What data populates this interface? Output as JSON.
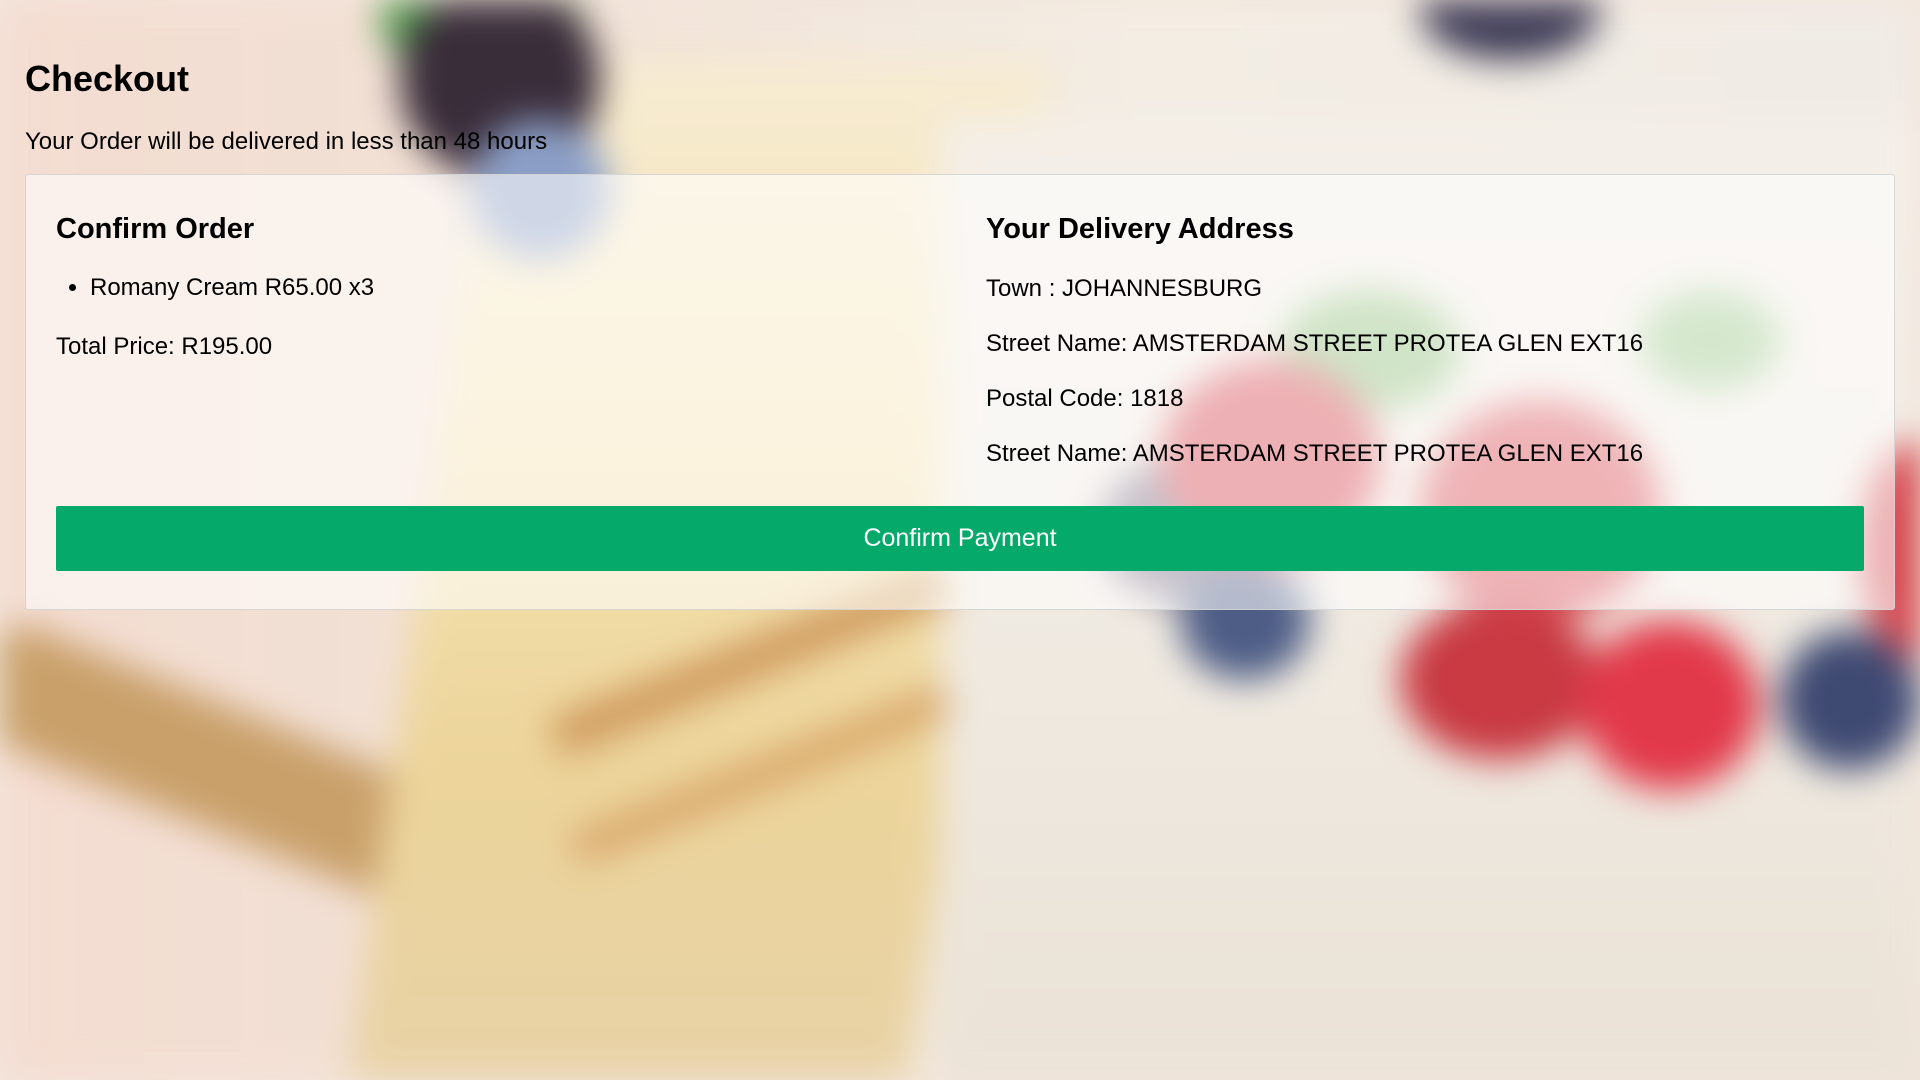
{
  "page": {
    "title": "Checkout",
    "subtitle": "Your Order will be delivered in less than 48 hours"
  },
  "order": {
    "heading": "Confirm Order",
    "items": [
      {
        "label": "Romany Cream R65.00 x3"
      }
    ],
    "total_label": "Total Price: R195.00"
  },
  "address": {
    "heading": "Your Delivery Address",
    "town": "Town : JOHANNESBURG",
    "street": "Street Name: AMSTERDAM STREET PROTEA GLEN EXT16",
    "postal_code": "Postal Code: 1818",
    "street_repeat": "Street Name: AMSTERDAM STREET PROTEA GLEN EXT16"
  },
  "actions": {
    "confirm_label": "Confirm Payment"
  },
  "colors": {
    "primary_button": "#05a96a"
  }
}
